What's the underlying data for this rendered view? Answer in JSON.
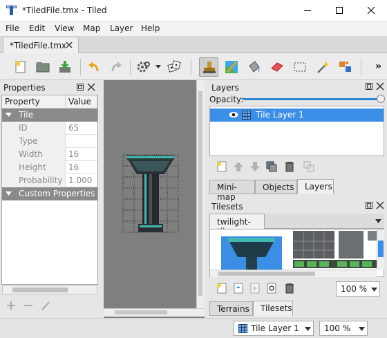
{
  "window": {
    "title": "*TiledFile.tmx - Tiled"
  },
  "menu": {
    "file": "File",
    "edit": "Edit",
    "view": "View",
    "map": "Map",
    "layer": "Layer",
    "help": "Help"
  },
  "document_tab": {
    "label": "*TiledFile.tmx"
  },
  "toolbar": {
    "overflow": "»",
    "tools": [
      "new-file-icon",
      "open-folder-icon",
      "save-icon",
      "undo-icon",
      "redo-icon",
      "command-gear-icon",
      "random-dice-icon",
      "stamp-brush-icon",
      "terrain-brush-icon",
      "bucket-fill-icon",
      "eraser-icon",
      "rectangle-select-icon",
      "magic-wand-icon",
      "select-same-tile-icon"
    ],
    "active_tool": "stamp-brush-icon"
  },
  "properties_panel": {
    "title": "Properties",
    "columns": {
      "property": "Property",
      "value": "Value"
    },
    "groups": {
      "tile": "Tile",
      "custom": "Custom Properties"
    },
    "rows": [
      {
        "key": "ID",
        "value": "65"
      },
      {
        "key": "Type",
        "value": ""
      },
      {
        "key": "Width",
        "value": "16"
      },
      {
        "key": "Height",
        "value": "16"
      },
      {
        "key": "Probability",
        "value": "1.000"
      }
    ]
  },
  "layers_panel": {
    "title": "Layers",
    "opacity_label": "Opacity:",
    "opacity": 1.0,
    "layers": [
      {
        "name": "Tile Layer 1",
        "visible": true,
        "selected": true
      }
    ],
    "tabs": {
      "minimap": "Mini-map",
      "objects": "Objects",
      "layers": "Layers"
    },
    "active_tab": "Layers"
  },
  "tilesets_panel": {
    "title": "Tilesets",
    "tileset_tab": "twilight-tiles",
    "zoom": "100 %",
    "tabs": {
      "terrains": "Terrains",
      "tilesets": "Tilesets"
    },
    "active_tab": "Tilesets"
  },
  "statusbar": {
    "layer": "Tile Layer 1",
    "zoom": "100 %"
  },
  "colors": {
    "selection": "#3a8ee6",
    "canvas": "#7f7f7f",
    "tile_teal": "#3fb8b0"
  }
}
